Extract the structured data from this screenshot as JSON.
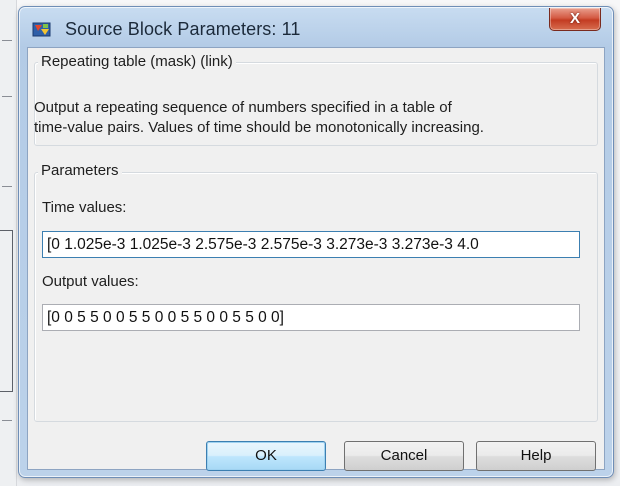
{
  "window": {
    "title": "Source Block Parameters: 11",
    "close_label": "X"
  },
  "mask_group": {
    "title": "Repeating table (mask) (link)",
    "description_line1": "Output a repeating sequence of numbers specified in a table of",
    "description_line2": "time-value pairs. Values of time should be monotonically increasing."
  },
  "parameters_group": {
    "title": "Parameters",
    "time_label": "Time values:",
    "time_value": "[0 1.025e-3 1.025e-3 2.575e-3 2.575e-3 3.273e-3 3.273e-3 4.0",
    "output_label": "Output values:",
    "output_value": "[0 0 5 5 0 0 5 5 0 0 5 5 0 0 5 5 0 0]"
  },
  "buttons": {
    "ok": "OK",
    "cancel": "Cancel",
    "help": "Help"
  },
  "colors": {
    "titlebar": "#bcd2ea",
    "client_bg": "#f0f0f0",
    "close_button": "#c33c22",
    "focus_border": "#3c7fb1"
  },
  "icons": {
    "app": "simulink-block-icon",
    "close": "close-icon"
  }
}
